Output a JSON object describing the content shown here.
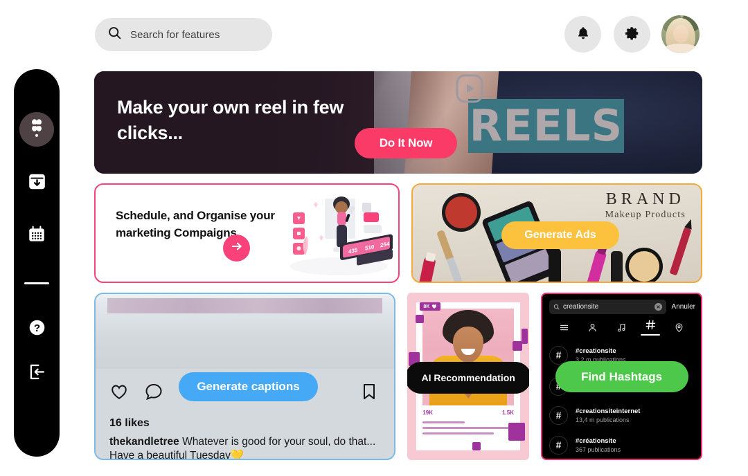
{
  "search": {
    "placeholder": "Search for features",
    "icon": "search-icon"
  },
  "header": {
    "notifications_icon": "bell-icon",
    "settings_icon": "gear-icon",
    "avatar_label": "User avatar"
  },
  "sidebar": {
    "items": [
      {
        "name": "logo",
        "icon": "clover-logo-icon",
        "active": true
      },
      {
        "name": "inbox",
        "icon": "inbox-download-icon",
        "active": false
      },
      {
        "name": "calendar",
        "icon": "calendar-icon",
        "active": false
      },
      {
        "name": "help",
        "icon": "question-mark-icon",
        "active": false
      },
      {
        "name": "logout",
        "icon": "logout-icon",
        "active": false
      }
    ]
  },
  "hero": {
    "title": "Make your own reel in few clicks...",
    "cta_label": "Do It Now",
    "reels_word": "REELS",
    "reels_icon": "reels-play-icon",
    "cta_color": "#fa3b68"
  },
  "schedule_card": {
    "title": "Schedule, and Organise your marketing Compaigns",
    "arrow_icon": "arrow-right-icon",
    "border_color": "#f9417a"
  },
  "ads_card": {
    "brand_line1": "BRAND",
    "brand_line2": "Makeup Products",
    "cta_label": "Generate Ads",
    "cta_color": "#fcc13d",
    "border_color": "#f6a93b"
  },
  "post_card": {
    "cta_label": "Generate captions",
    "cta_color": "#45a9f5",
    "border_color": "#7bbbe8",
    "likes": "16 likes",
    "caption_user": "thekandletree",
    "caption_text": " Whatever is good for your soul, do that... Have a beautiful Tuesday💛",
    "icons": [
      "heart-icon",
      "comment-icon",
      "share-icon",
      "bookmark-icon"
    ]
  },
  "ai_card": {
    "cta_label": "AI Recommendation",
    "cta_color": "#0b0b0b",
    "badge_top": "8K",
    "stat_left": "19K",
    "stat_right": "1.5K"
  },
  "hashtag_card": {
    "search_value": "creationsite",
    "cancel_label": "Annuler",
    "cta_label": "Find Hashtags",
    "cta_color": "#4ec84a",
    "border_color": "#f42a72",
    "tabs": [
      {
        "icon": "menu-icon",
        "active": false
      },
      {
        "icon": "person-icon",
        "active": false
      },
      {
        "icon": "music-note-icon",
        "active": false
      },
      {
        "icon": "hashtag-icon",
        "active": true
      },
      {
        "icon": "location-pin-icon",
        "active": false
      }
    ],
    "results": [
      {
        "tag": "#creationsite",
        "count": "3,2 m publications"
      },
      {
        "tag": "#creationsiteinternet",
        "count": "13,4 m publications"
      },
      {
        "tag": "#créationsite",
        "count": "367 publications"
      }
    ]
  }
}
